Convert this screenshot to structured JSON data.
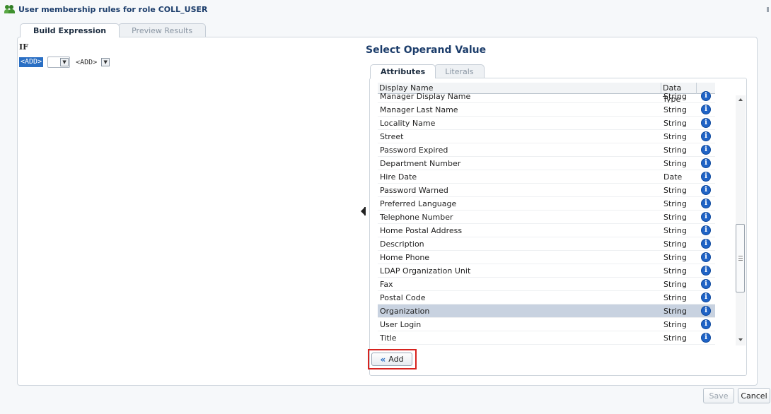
{
  "header": {
    "title": "User membership rules for role COLL_USER",
    "icon": "roles-icon"
  },
  "tabs": [
    {
      "label": "Build Expression",
      "active": true
    },
    {
      "label": "Preview Results",
      "active": false
    }
  ],
  "expression": {
    "keyword": "IF",
    "left_operand": "<ADD>",
    "right_operand": "<ADD>"
  },
  "operand_panel": {
    "title": "Select Operand Value",
    "tabs": [
      {
        "label": "Attributes",
        "active": true
      },
      {
        "label": "Literals",
        "active": false
      }
    ],
    "columns": [
      "Display Name",
      "Data Type"
    ],
    "rows": [
      {
        "name": "Manager Display Name",
        "type": "String",
        "info": "info-icon"
      },
      {
        "name": "Manager Last Name",
        "type": "String",
        "info": "info-icon"
      },
      {
        "name": "Locality Name",
        "type": "String",
        "info": "info-icon"
      },
      {
        "name": "Street",
        "type": "String",
        "info": "info-icon"
      },
      {
        "name": "Password Expired",
        "type": "String",
        "info": "info-icon"
      },
      {
        "name": "Department Number",
        "type": "String",
        "info": "info-icon"
      },
      {
        "name": "Hire Date",
        "type": "Date",
        "info": "info-icon"
      },
      {
        "name": "Password Warned",
        "type": "String",
        "info": "info-icon"
      },
      {
        "name": "Preferred Language",
        "type": "String",
        "info": "info-icon"
      },
      {
        "name": "Telephone Number",
        "type": "String",
        "info": "info-icon"
      },
      {
        "name": "Home Postal Address",
        "type": "String",
        "info": "info-icon"
      },
      {
        "name": "Description",
        "type": "String",
        "info": "info-icon"
      },
      {
        "name": "Home Phone",
        "type": "String",
        "info": "info-icon"
      },
      {
        "name": "LDAP Organization Unit",
        "type": "String",
        "info": "info-icon"
      },
      {
        "name": "Fax",
        "type": "String",
        "info": "info-icon"
      },
      {
        "name": "Postal Code",
        "type": "String",
        "info": "info-icon"
      },
      {
        "name": "Organization",
        "type": "String",
        "info": "info-icon",
        "selected": true
      },
      {
        "name": "User Login",
        "type": "String",
        "info": "info-icon"
      },
      {
        "name": "Title",
        "type": "String",
        "info": "info-icon"
      }
    ],
    "add_button": "Add"
  },
  "footer": {
    "save": "Save",
    "cancel": "Cancel"
  },
  "colors": {
    "title": "#1c3d6b",
    "selection": "#c8d2e0",
    "info_icon": "#1f63c6",
    "highlight_frame": "#d7231f"
  }
}
